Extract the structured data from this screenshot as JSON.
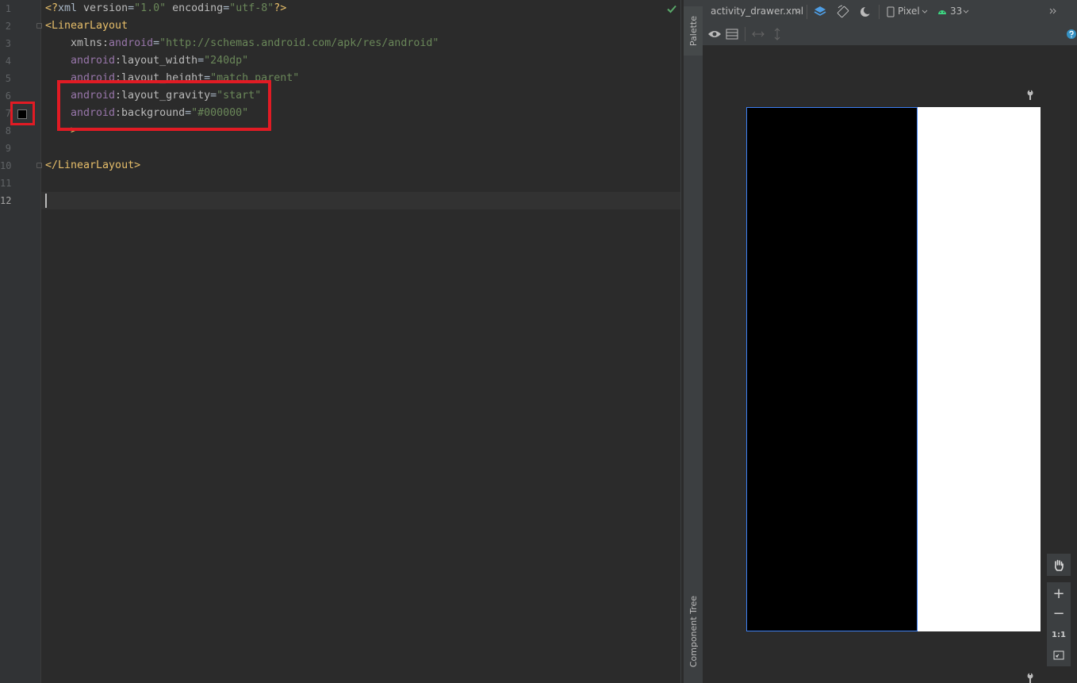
{
  "editor": {
    "line_numbers": [
      "1",
      "2",
      "3",
      "4",
      "5",
      "6",
      "7",
      "8",
      "9",
      "10",
      "11",
      "12"
    ],
    "lines": {
      "l1": {
        "open": "<?",
        "tag": "xml",
        "a1": " version",
        "e1": "=",
        "v1": "\"1.0\"",
        "a2": " encoding",
        "e2": "=",
        "v2": "\"utf-8\"",
        "close": "?>"
      },
      "l2": {
        "tag": "<LinearLayout"
      },
      "l3": {
        "attr": "xmlns:",
        "ns": "android",
        "eq": "=",
        "val": "\"http://schemas.android.com/apk/res/android\""
      },
      "l4": {
        "ns": "android",
        "attr": ":layout_width",
        "eq": "=",
        "val": "\"240dp\""
      },
      "l5": {
        "ns": "android",
        "attr": ":layout_height",
        "eq": "=",
        "val": "\"match_parent\""
      },
      "l6": {
        "ns": "android",
        "attr": ":layout_gravity",
        "eq": "=",
        "val": "\"start\""
      },
      "l7": {
        "ns": "android",
        "attr": ":background",
        "eq": "=",
        "val": "\"#000000\""
      },
      "l8": {
        "tag": ">"
      },
      "l10": {
        "tag": "</LinearLayout>"
      }
    },
    "current_line": "12",
    "swatch_color": "#000000",
    "highlight_color": "#e11b24",
    "status_icon": "check-icon"
  },
  "side_tabs": {
    "palette": "Palette",
    "component_tree": "Component Tree"
  },
  "toolbar": {
    "file_name": "activity_drawer.xml",
    "device": "Pixel",
    "api_level": "33",
    "icons": [
      "layers-icon",
      "orientation-icon",
      "night-mode-icon",
      "device-icon",
      "android-icon",
      "more-icon",
      "help-icon",
      "eye-icon",
      "blueprint-icon",
      "resize-horizontal-icon",
      "resize-vertical-icon"
    ]
  },
  "zoom": {
    "plus": "+",
    "minus": "−",
    "one_to_one": "1:1"
  },
  "preview": {
    "drawer_color": "#000000",
    "screen_color": "#ffffff",
    "selection_color": "#3d7ff2"
  }
}
